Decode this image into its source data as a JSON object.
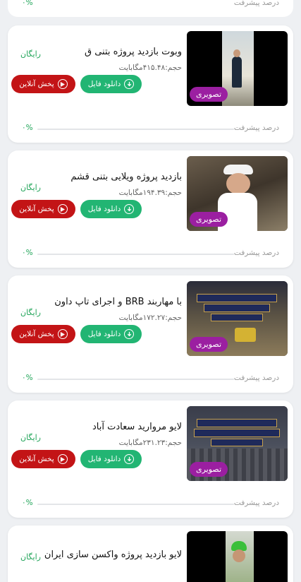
{
  "top_fragment": {
    "progress_label": "درصد پیشرفت",
    "progress_value": "٠%"
  },
  "common": {
    "badge": "تصویری",
    "free": "رایگان",
    "download": "دانلود فایل",
    "play": "پخش آنلاین",
    "progress_label": "درصد پیشرفت"
  },
  "items": [
    {
      "title": "وبوت    بازدید پروژه بتنی ق",
      "size": "حجم:۴۱۵.۴۸مگابایت",
      "progress_value": "٠%",
      "progress": 0
    },
    {
      "title": "بازدید پروژه ویلایی بتنی قشم",
      "size": "حجم:۱۹۴.۳۹مگابایت",
      "progress_value": "٠%",
      "progress": 0
    },
    {
      "title": "با مهاربند BRB و اجرای تاپ داون",
      "size": "حجم:۱۷۲.۲۷مگابایت",
      "progress_value": "٠%",
      "progress": 0
    },
    {
      "title": "لایو    مروارید سعادت آباد",
      "size": "حجم:۲۳۱.۲۳مگابایت",
      "progress_value": "٠%",
      "progress": 0
    },
    {
      "title": "لایو بازدید پروژه واکسن سازی ایران",
      "size": "",
      "progress_value": "",
      "progress": 0
    }
  ]
}
